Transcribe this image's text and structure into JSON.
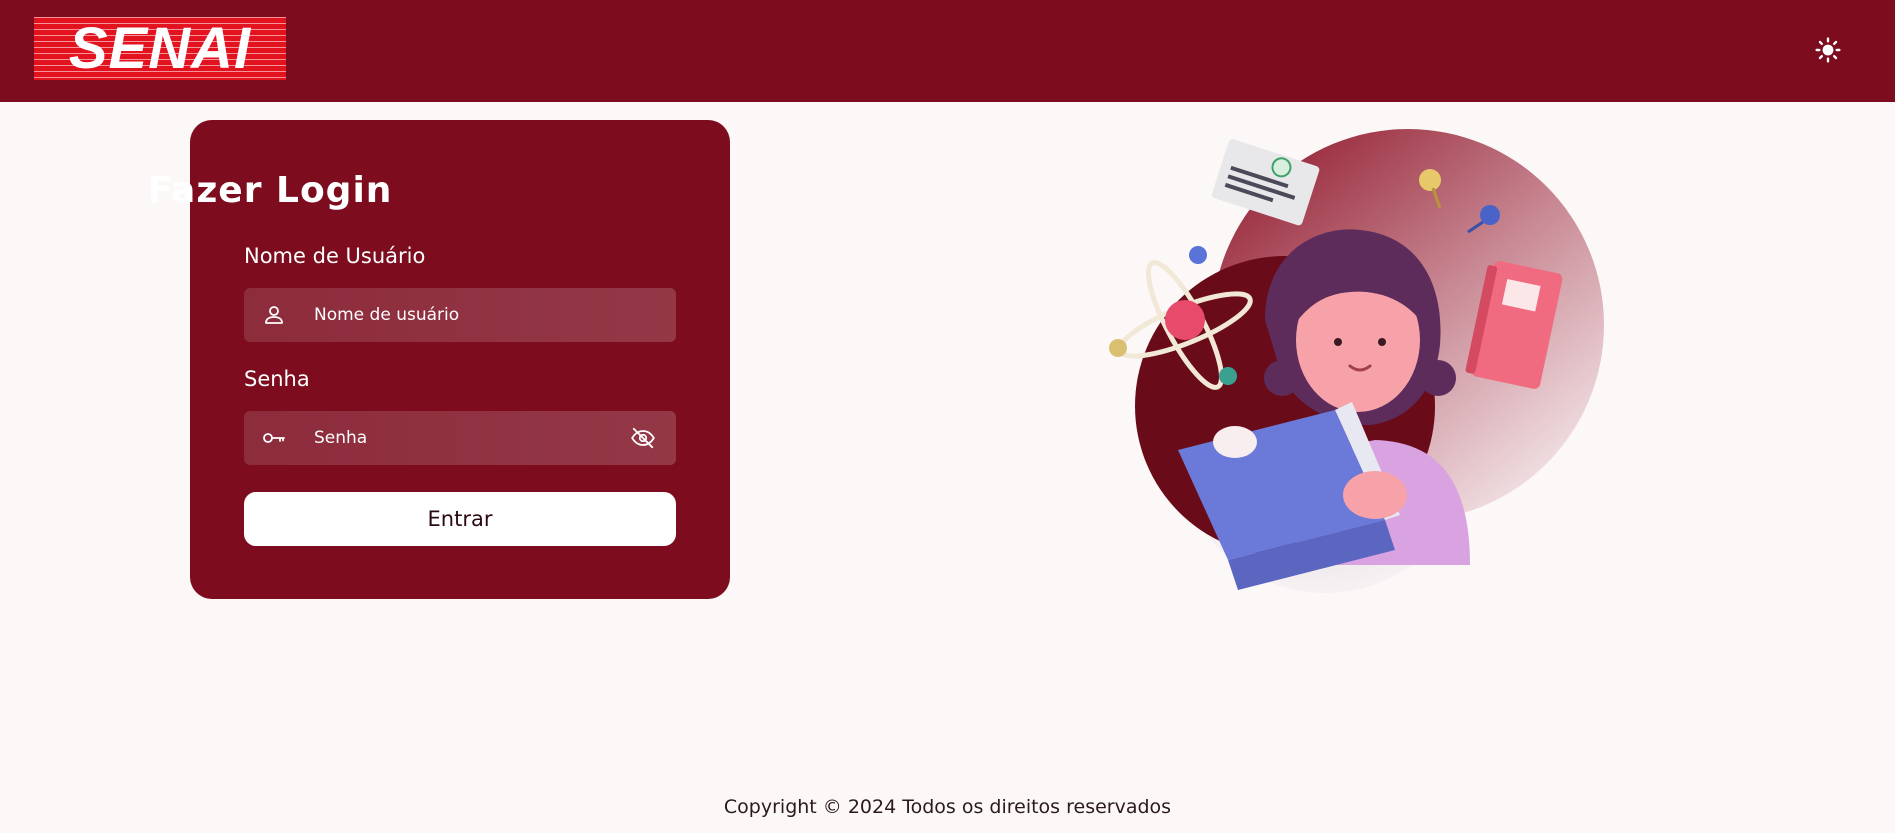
{
  "header": {
    "logo_text": "SENAI",
    "theme_toggle_icon": "sun-icon",
    "background_color": "#7c0c1e"
  },
  "login": {
    "title": "Fazer Login",
    "username": {
      "label": "Nome de Usuário",
      "placeholder": "Nome de usuário",
      "value": "",
      "icon": "user-icon"
    },
    "password": {
      "label": "Senha",
      "placeholder": "Senha",
      "value": "",
      "icon": "key-icon",
      "toggle_icon": "eye-off-icon"
    },
    "submit_label": "Entrar"
  },
  "illustration": {
    "subject": "girl-reading-book-illustration"
  },
  "footer": {
    "copyright": "Copyright © 2024 Todos os direitos reservados"
  },
  "colors": {
    "primary": "#7c0c1e",
    "page_background": "#fdf8f8",
    "logo_red": "#e3121f"
  }
}
